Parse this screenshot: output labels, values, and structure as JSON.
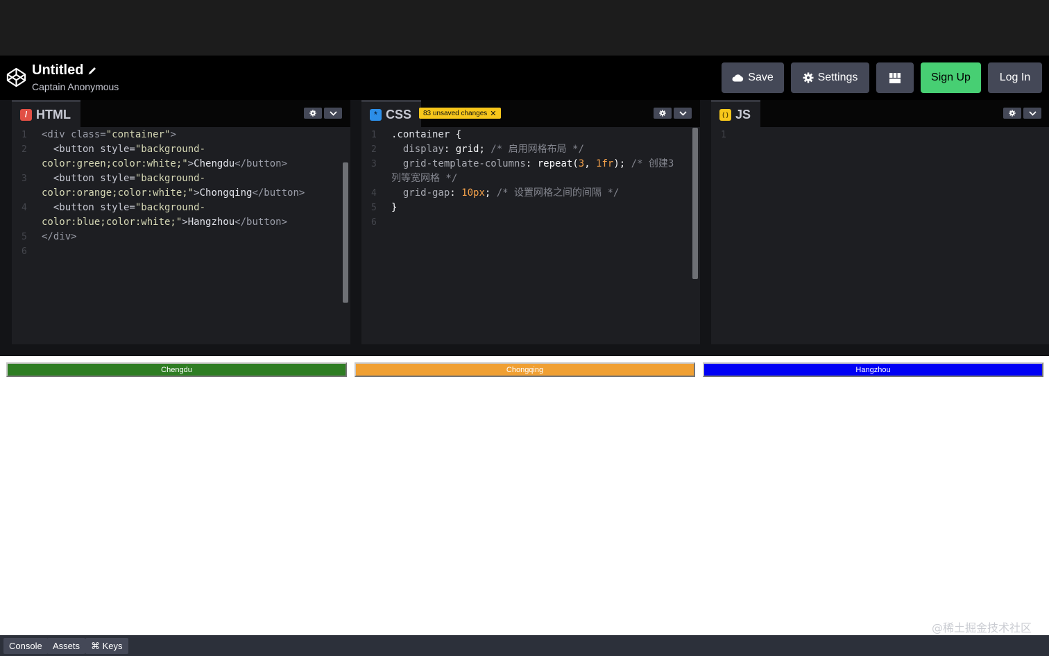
{
  "header": {
    "pen_title": "Untitled",
    "owner": "Captain Anonymous",
    "buttons": {
      "save": "Save",
      "settings": "Settings",
      "sign_up": "Sign Up",
      "log_in": "Log In"
    },
    "icons": {
      "logo": "codepen-logo-icon",
      "edit": "pencil-icon",
      "save": "cloud-icon",
      "settings": "gear-icon",
      "layout": "layout-grid-icon"
    }
  },
  "editors": {
    "html": {
      "tab_label": "HTML",
      "icon_glyph": "/",
      "line_numbers": [
        "1",
        "2",
        "",
        "3",
        "",
        "4",
        "",
        "5",
        "6"
      ],
      "tokens": {
        "l1": [
          "<div class=",
          "\"container\"",
          ">"
        ],
        "l2a": [
          "  <button style=",
          "\"background-"
        ],
        "l2b": [
          "color:green;color:white;\"",
          ">",
          "Chengdu",
          "</button>"
        ],
        "l3a": [
          "  <button style=",
          "\"background-"
        ],
        "l3b": [
          "color:orange;color:white;\"",
          ">",
          "Chongqing",
          "</button>"
        ],
        "l4a": [
          "  <button style=",
          "\"background-"
        ],
        "l4b": [
          "color:blue;color:white;\"",
          ">",
          "Hangzhou",
          "</button>"
        ],
        "l5": [
          "</div>"
        ]
      }
    },
    "css": {
      "tab_label": "CSS",
      "icon_glyph": "*",
      "unsaved_badge": "83 unsaved changes",
      "line_numbers": [
        "1",
        "2",
        "3",
        "",
        "4",
        "5",
        "6"
      ],
      "tokens": {
        "l1": [
          ".container",
          " {"
        ],
        "l2": [
          "  display",
          ": ",
          "grid",
          "; ",
          "/* 启用网格布局 */"
        ],
        "l3a": [
          "  grid-template-columns",
          ": ",
          "repeat(",
          "3",
          ", ",
          "1fr",
          "); ",
          "/* 创建3"
        ],
        "l3b": [
          "列等宽网格 */"
        ],
        "l4": [
          "  grid-gap",
          ": ",
          "10px",
          "; ",
          "/* 设置网格之间的间隔 */"
        ],
        "l5": [
          "}"
        ]
      }
    },
    "js": {
      "tab_label": "JS",
      "icon_glyph": "( )",
      "line_numbers": [
        "1"
      ]
    }
  },
  "preview": {
    "buttons": [
      {
        "label": "Chengdu",
        "color": "#2e7d23"
      },
      {
        "label": "Chongqing",
        "color": "#f0a033"
      },
      {
        "label": "Hangzhou",
        "color": "#0000f5"
      }
    ],
    "watermark": "@稀土掘金技术社区"
  },
  "footer": {
    "console": "Console",
    "assets": "Assets",
    "keys": "⌘ Keys"
  },
  "colors": {
    "accent_green": "#47cf73",
    "button_bg": "#444857",
    "badge_yellow": "#f7c71b"
  }
}
